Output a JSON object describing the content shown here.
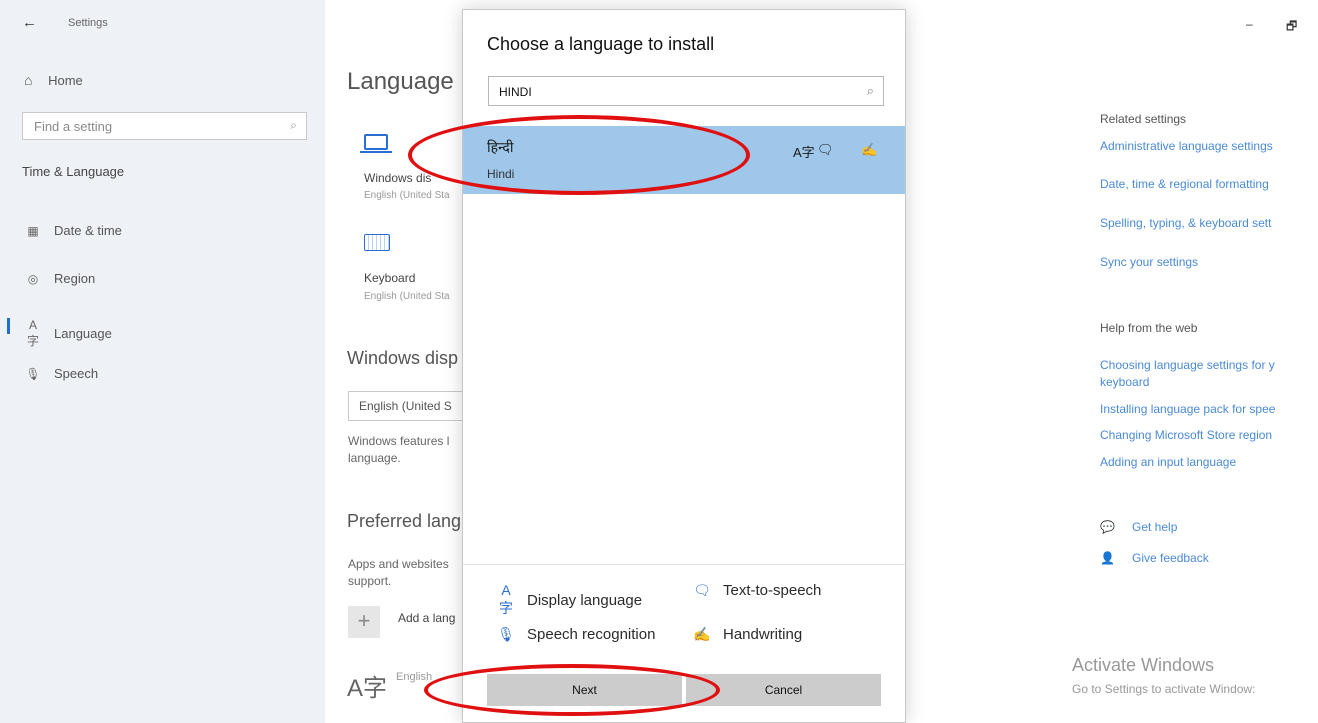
{
  "sidebar": {
    "back_icon": "←",
    "title": "Settings",
    "home": {
      "icon": "home-icon",
      "label": "Home"
    },
    "search_placeholder": "Find a setting",
    "section": "Time & Language",
    "items": [
      {
        "icon": "calendar-clock-icon",
        "label": "Date & time"
      },
      {
        "icon": "globe-icon",
        "label": "Region"
      },
      {
        "icon": "language-icon",
        "label": "Language",
        "active": true
      },
      {
        "icon": "microphone-icon",
        "label": "Speech"
      }
    ]
  },
  "main": {
    "page_title": "Language",
    "windows_display": {
      "label": "Windows dis",
      "sub": "English (United Sta"
    },
    "keyboard": {
      "label": "Keyboard",
      "sub": "English (United Sta"
    },
    "windows_display_heading": "Windows disp",
    "display_dropdown_value": "English (United S",
    "display_desc": "Windows features l\nlanguage.",
    "preferred_heading": "Preferred lang",
    "preferred_desc": "Apps and websites\nsupport.",
    "add_language": "Add a lang",
    "english_item": "English"
  },
  "dialog": {
    "title": "Choose a language to install",
    "search_value": "HINDI",
    "result": {
      "native_name": "हिन्दी",
      "english_name": "Hindi",
      "feature_icons": [
        "display-language-icon",
        "text-to-speech-icon",
        "handwriting-icon"
      ]
    },
    "legend": [
      {
        "icon": "display-language-icon",
        "label": "Display language"
      },
      {
        "icon": "text-to-speech-icon",
        "label": "Text-to-speech"
      },
      {
        "icon": "speech-recognition-icon",
        "label": "Speech recognition"
      },
      {
        "icon": "handwriting-icon",
        "label": "Handwriting"
      }
    ],
    "next_label": "Next",
    "cancel_label": "Cancel"
  },
  "right_pane": {
    "related_title": "Related settings",
    "related_links": [
      "Administrative language settings",
      "Date, time & regional formatting",
      "Spelling, typing, & keyboard sett",
      "Sync your settings"
    ],
    "help_title": "Help from the web",
    "help_links": [
      "Choosing language settings for y\nkeyboard",
      "Installing language pack for spee",
      "Changing Microsoft Store region",
      "Adding an input language"
    ],
    "get_help": "Get help",
    "give_feedback": "Give feedback"
  },
  "window_controls": {
    "minimize": "–",
    "restore": "🗗"
  },
  "watermark": {
    "title": "Activate Windows",
    "subtitle": "Go to Settings to activate Window:"
  },
  "colors": {
    "accent": "#2a6ed1",
    "link": "#4a8ad6",
    "selection": "#9ec7ea",
    "annotation": "#e01010"
  }
}
